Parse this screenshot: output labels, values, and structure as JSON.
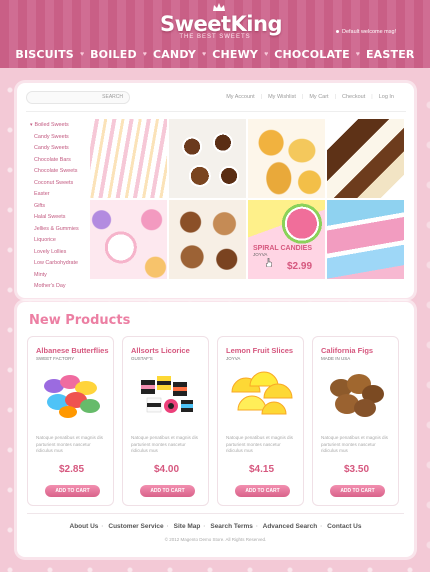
{
  "header": {
    "logo": "SweetKing",
    "tagline": "THE BEST SWEETS",
    "welcome": "Default welcome msg!",
    "nav": [
      "BISCUITS",
      "BOILED",
      "CANDY",
      "CHEWY",
      "CHOCOLATE",
      "EASTER"
    ]
  },
  "search": {
    "placeholder": "",
    "button": "SEARCH"
  },
  "top_links": [
    "My Account",
    "My Wishlist",
    "My Cart",
    "Checkout",
    "Log In"
  ],
  "categories": [
    {
      "label": "Boiled Sweets",
      "sub": false
    },
    {
      "label": "Candy Sweets",
      "sub": true
    },
    {
      "label": "Candy Sweets",
      "sub": true
    },
    {
      "label": "Chocolate Bars",
      "sub": true
    },
    {
      "label": "Chocolate Sweets",
      "sub": true
    },
    {
      "label": "Coconut Sweets",
      "sub": true
    },
    {
      "label": "Easter",
      "sub": true
    },
    {
      "label": "Gifts",
      "sub": true
    },
    {
      "label": "Halal Sweets",
      "sub": true
    },
    {
      "label": "Jellies & Gummies",
      "sub": true
    },
    {
      "label": "Liquorice",
      "sub": true
    },
    {
      "label": "Lovely Lollies",
      "sub": true
    },
    {
      "label": "Low Carbohydrate",
      "sub": true
    },
    {
      "label": "Minty",
      "sub": true
    },
    {
      "label": "Mother's Day",
      "sub": true
    }
  ],
  "gallery_feature": {
    "name": "SPIRAL CANDIES",
    "brand": "JOYVA",
    "price": "$2.99"
  },
  "new_products": {
    "title": "New Products",
    "items": [
      {
        "name": "Albanese Butterflies",
        "brand": "SWEET FACTORY",
        "desc": "Natoque penatibus et magnis dis parturient montes nascetur ridiculus mus",
        "price": "$2.85",
        "button": "ADD TO CART"
      },
      {
        "name": "Allsorts Licorice",
        "brand": "GUSTAF'S",
        "desc": "Natoque penatibus et magnis dis parturient montes nascetur ridiculus mus",
        "price": "$4.00",
        "button": "ADD TO CART"
      },
      {
        "name": "Lemon Fruit Slices",
        "brand": "JOYVA",
        "desc": "Natoque penatibus et magnis dis parturient montes nascetur ridiculus mus",
        "price": "$4.15",
        "button": "ADD TO CART"
      },
      {
        "name": "California Figs",
        "brand": "MADE IN USA",
        "desc": "Natoque penatibus et magnis dis parturient montes nascetur ridiculus mus",
        "price": "$3.50",
        "button": "ADD TO CART"
      }
    ]
  },
  "footer": {
    "links": [
      "About Us",
      "Customer Service",
      "Site Map",
      "Search Terms",
      "Advanced Search",
      "Contact Us"
    ],
    "copyright": "© 2012 Magento Demo Store. All Rights Reserved."
  },
  "colors": {
    "brand_pink": "#d6587f",
    "header_stripe": "#c95f86",
    "background": "#f3c9d6"
  }
}
